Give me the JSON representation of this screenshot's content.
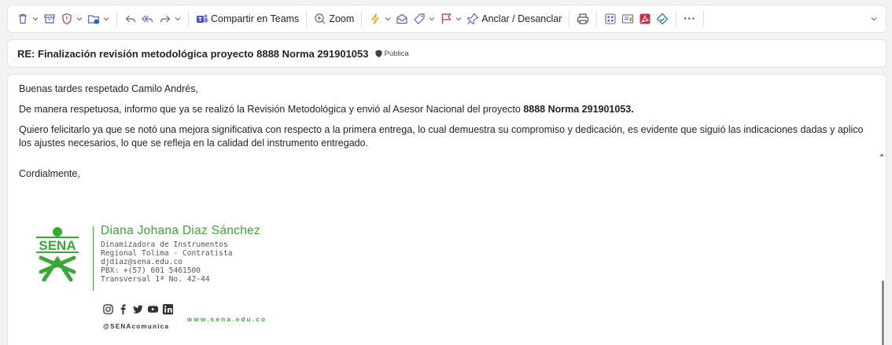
{
  "toolbar": {
    "share_teams_label": "Compartir en Teams",
    "zoom_label": "Zoom",
    "pin_label": "Anclar / Desanclar",
    "more_label": "···"
  },
  "message": {
    "subject": "RE: Finalización revisión metodológica proyecto 8888 Norma 291901053",
    "sensitivity": "Pública",
    "greeting": "Buenas tardes respetado Camilo Andrés,",
    "p1_text": "De manera respetuosa, informo que ya se realizó la Revisión Metodológica y envió al Asesor Nacional del proyecto ",
    "p1_bold": "8888 Norma 291901053.",
    "p2": "Quiero felicitarlo ya que se notó una mejora significativa con respecto a la primera entrega, lo cual demuestra su compromiso y dedicación, es evidente que siguió las indicaciones dadas y aplico los ajustes necesarios, lo que se refleja en la calidad del instrumento entregado.",
    "closing": "Cordialmente,"
  },
  "signature": {
    "logo_text": "SENA",
    "name": "Diana Johana Diaz Sánchez",
    "role": "Dinamizadora de Instrumentos",
    "region": "Regional Tolima - Contratista",
    "email": "djdiaz@sena.edu.co",
    "phone": "PBX: +(57) 601 5461500",
    "address": "Transversal 1ª No. 42-44",
    "handle": "@SENAcomunica",
    "website": "www.sena.edu.co"
  },
  "colors": {
    "brand_green": "#39a935",
    "teams_purple": "#4b53bc",
    "pdf_red": "#c4314b",
    "accent_blue": "#0f6cbd"
  }
}
